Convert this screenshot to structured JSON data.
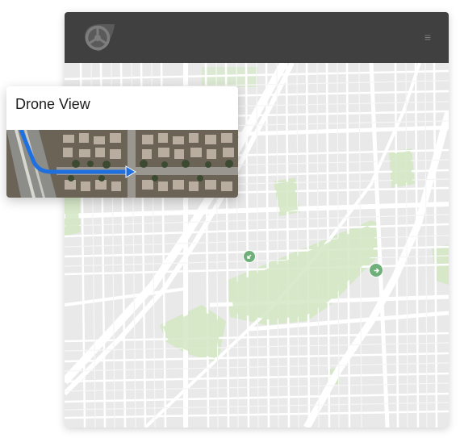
{
  "header": {
    "logo_icon": "steering-wheel-logo-icon",
    "menu_icon": "hamburger-menu-icon",
    "menu_glyph": "≡",
    "background_color": "#404040"
  },
  "drone_card": {
    "title": "Drone View",
    "image_icon": "aerial-photo",
    "route_color": "#1e6fe0"
  },
  "map": {
    "background_color": "#e9e9e9",
    "road_color": "#ffffff",
    "park_color": "#d6e8c8",
    "pins": [
      {
        "name": "map-pin-west",
        "icon": "arrow-icon",
        "color": "#6fb07a"
      },
      {
        "name": "map-pin-east",
        "icon": "arrow-right-icon",
        "color": "#6fb07a"
      }
    ]
  }
}
